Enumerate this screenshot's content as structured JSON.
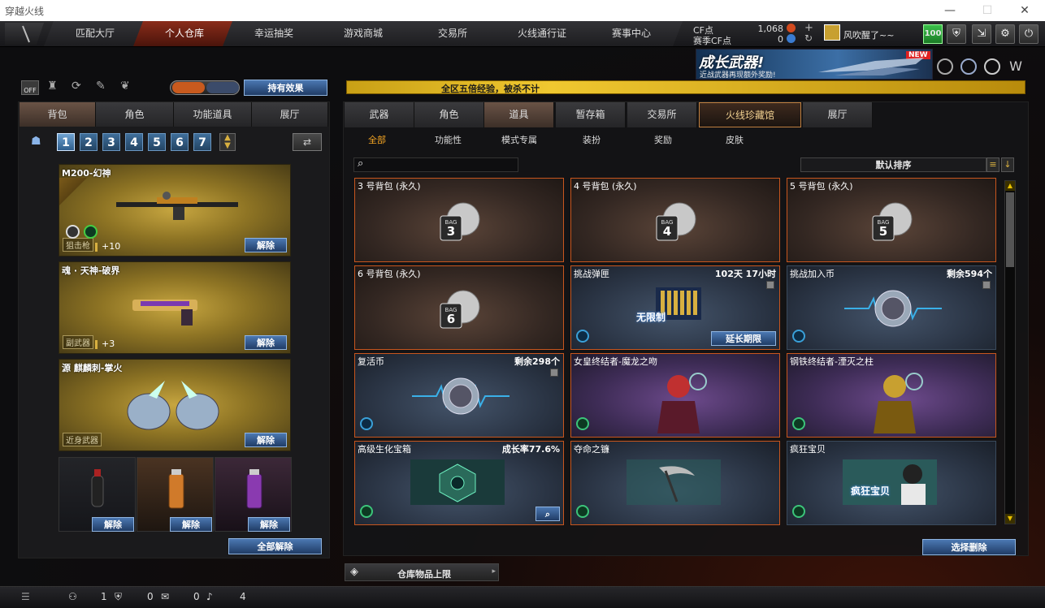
{
  "window": {
    "title": "穿越火线"
  },
  "nav": {
    "tabs": [
      "匹配大厅",
      "个人仓库",
      "幸运抽奖",
      "游戏商城",
      "交易所",
      "火线通行证",
      "赛事中心"
    ],
    "active_index": 1,
    "cf_points_label": "CF点",
    "cf_points_value": "1,068",
    "match_cf_label": "赛季CF点",
    "match_cf_value": "0",
    "username": "风吹醒了~~",
    "level_badge": "100"
  },
  "banner": {
    "title": "成长武器!",
    "subtitle": "近战武器再现额外奖励!",
    "badge": "NEW"
  },
  "notice": {
    "text": "全区五倍经验，被杀不计"
  },
  "left": {
    "effects_button": "持有效果",
    "off_label": "OFF",
    "tabs": [
      "背包",
      "角色",
      "功能道具",
      "展厅"
    ],
    "active_tab": 0,
    "bag_numbers": [
      "1",
      "2",
      "3",
      "4",
      "5",
      "6",
      "7"
    ],
    "active_bag": 0,
    "weapons": [
      {
        "name": "M200-幻神",
        "class": "狙击枪",
        "level": "+10",
        "button": "解除"
      },
      {
        "name": "魂 · 天神-破界",
        "class": "副武器",
        "level": "+3",
        "button": "解除"
      },
      {
        "name": "源 麒麟刺-掌火",
        "class": "近身武器",
        "level": "",
        "button": "解除"
      }
    ],
    "grenade_buttons": [
      "解除",
      "解除",
      "解除"
    ],
    "unequip_all": "全部解除"
  },
  "right": {
    "tabs": [
      "武器",
      "角色",
      "道具",
      "暂存箱",
      "交易所",
      "火线珍藏馆",
      "展厅"
    ],
    "active_tab": 2,
    "highlight_tab": 5,
    "subtabs": [
      "全部",
      "功能性",
      "模式专属",
      "装扮",
      "奖励",
      "皮肤"
    ],
    "active_subtab": 0,
    "search_placeholder": "",
    "sort_label": "默认排序",
    "items": [
      {
        "name": "3 号背包 (永久)",
        "right": "",
        "icon": "bag-3-icon",
        "bagnum": "3"
      },
      {
        "name": "4 号背包 (永久)",
        "right": "",
        "icon": "bag-4-icon",
        "bagnum": "4"
      },
      {
        "name": "5 号背包 (永久)",
        "right": "",
        "icon": "bag-5-icon",
        "bagnum": "5"
      },
      {
        "name": "6 号背包 (永久)",
        "right": "",
        "icon": "bag-6-icon",
        "bagnum": "6"
      },
      {
        "name": "挑战弹匣",
        "right": "102天 17小时",
        "icon": "ammo-icon",
        "button": "延长期限",
        "art_text": "无限制"
      },
      {
        "name": "挑战加入币",
        "right": "剩余594个",
        "icon": "join-coin-icon"
      },
      {
        "name": "复活币",
        "right": "剩余298个",
        "icon": "revive-coin-icon"
      },
      {
        "name": "女皇终结者-魔龙之吻",
        "right": "",
        "icon": "character-icon"
      },
      {
        "name": "钢铁终结者-湮灭之柱",
        "right": "",
        "icon": "character-icon"
      },
      {
        "name": "高级生化宝箱",
        "right": "成长率77.6%",
        "icon": "bio-chest-icon"
      },
      {
        "name": "夺命之镰",
        "right": "",
        "icon": "scythe-icon"
      },
      {
        "name": "疯狂宝贝",
        "right": "",
        "icon": "crazy-baby-icon",
        "art_text": "疯狂宝贝"
      }
    ],
    "delete_button": "选择删除",
    "storage_limit": "仓库物品上限"
  },
  "bottom": {
    "counts": [
      "1",
      "0",
      "0",
      "4"
    ]
  }
}
